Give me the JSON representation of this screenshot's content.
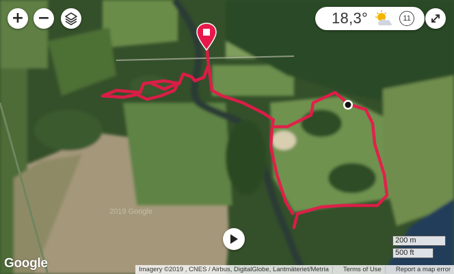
{
  "controls": {
    "zoom_in_label": "+",
    "zoom_out_label": "−",
    "layers_icon": "layers-icon",
    "fullscreen_icon": "expand-icon",
    "play_icon": "play-icon"
  },
  "weather": {
    "temperature": "18,3°",
    "condition_icon": "sun-cloud-icon",
    "wind_speed": "11"
  },
  "route": {
    "color": "#e8194a",
    "start_marker_icon": "stop-pin-icon",
    "end_marker_icon": "dot-marker-icon"
  },
  "scale": {
    "metric": "200 m",
    "imperial": "500 ft"
  },
  "branding": {
    "logo": "Google",
    "watermark": "2019 Google"
  },
  "attribution": {
    "imagery": "Imagery ©2019 , CNES / Airbus, DigitalGlobe, Lantmäteriet/Metria",
    "terms": "Terms of Use",
    "report": "Report a map error"
  }
}
